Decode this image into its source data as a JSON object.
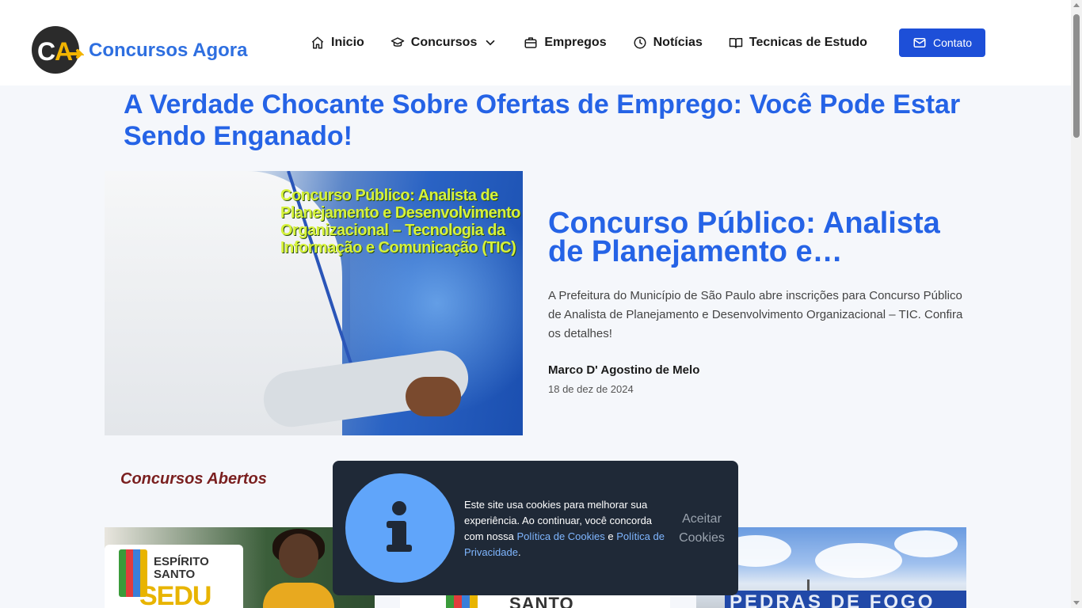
{
  "header": {
    "brand": "Concursos Agora",
    "logo_letters": "CA",
    "nav": [
      {
        "label": "Inicio",
        "icon": "home-icon"
      },
      {
        "label": "Concursos",
        "icon": "graduation-cap-icon",
        "has_dropdown": true
      },
      {
        "label": "Empregos",
        "icon": "briefcase-icon"
      },
      {
        "label": "Notícias",
        "icon": "clock-icon"
      },
      {
        "label": "Tecnicas de Estudo",
        "icon": "book-icon"
      }
    ],
    "contact_label": "Contato"
  },
  "main": {
    "page_title": "A Verdade Chocante Sobre Ofertas de Emprego: Você Pode Estar Sendo Enganado!",
    "featured": {
      "image_overlay_text": "Concurso Público: Analista de Planejamento e Desenvolvimento Organizacional – Tecnologia da Informação e Comunicação (TIC)",
      "title": "Concurso Público: Analista de Planejamento e…",
      "description": "A Prefeitura do Município de São Paulo abre inscrições para Concurso Público de Analista de Planejamento e Desenvolvimento Organizacional – TIC. Confira os detalhes!",
      "author": "Marco D' Agostino de Melo",
      "date": "18 de dez de 2024"
    },
    "section_title": "Concursos Abertos",
    "cards": [
      {
        "logo_text": "ESPÍRITO SANTO",
        "brand_text": "SEDU"
      },
      {
        "logo_text": "SANTO"
      },
      {
        "sign_text": "PEDRAS DE FOGO"
      }
    ]
  },
  "cookie_banner": {
    "text_before": "Este site usa cookies para melhorar sua experiência. Ao continuar, você concorda com nossa ",
    "link_cookies": "Política de Cookies",
    "text_middle": " e ",
    "link_privacy": "Política de Privacidade",
    "text_after": ".",
    "accept_label": "Aceitar Cookies"
  },
  "colors": {
    "accent": "#2563e6",
    "button": "#1d4fd8",
    "section_title": "#7a1f1f",
    "cookie_bg": "#1f2937",
    "cookie_icon": "#60a5fa"
  }
}
